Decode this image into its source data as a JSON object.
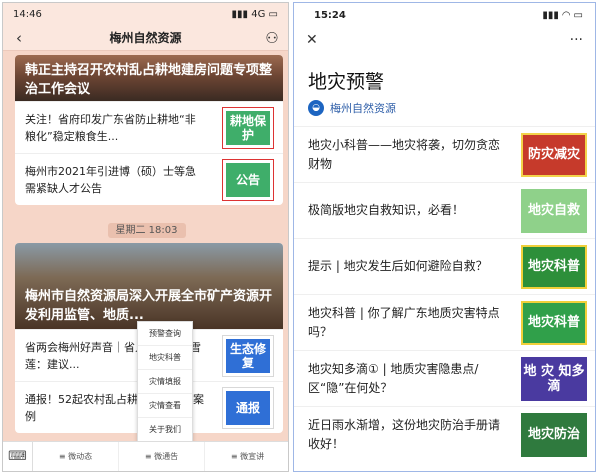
{
  "left": {
    "status": {
      "time": "14:46",
      "signal": "4G"
    },
    "navbar": {
      "title": "梅州自然资源"
    },
    "card1": {
      "hero_text": "韩正主持召开农村乱占耕地建房问题专项整治工作会议",
      "rows": [
        {
          "text": "关注！省府印发广东省防止耕地“非粮化”稳定粮食生...",
          "thumb": "耕地保护"
        },
        {
          "text": "梅州市2021年引进博（硕）士等急需紧缺人才公告",
          "thumb": "公告"
        }
      ]
    },
    "date_label": "星期二 18:03",
    "card2": {
      "hero_text": "梅州市自然资源局深入开展全市矿产资源开发利用监管、地质...",
      "rows": [
        {
          "text": "省两会梅州好声音｜省人大代表张雪莲：建议...",
          "thumb": "生态修复"
        },
        {
          "text": "通报！52起农村乱占耕地建房典型案例",
          "thumb": "通报"
        }
      ]
    },
    "popup_menu": [
      "预警查询",
      "地灾科普",
      "灾情填报",
      "灾情查看",
      "关于我们"
    ],
    "bottom_menu": [
      "微动态",
      "微通告",
      "微宣讲"
    ]
  },
  "right": {
    "status": {
      "time": "15:24"
    },
    "page_title": "地灾预警",
    "account_name": "梅州自然资源",
    "articles": [
      {
        "title": "地灾小科普——地灾将袭，切勿贪恋财物",
        "thumb": "防灾减灾",
        "style": "t1"
      },
      {
        "title": "极简版地灾自救知识，必看！",
        "thumb": "地灾自救",
        "style": "t2"
      },
      {
        "title": "提示 | 地灾发生后如何避险自救？",
        "thumb": "地灾科普",
        "style": "t3"
      },
      {
        "title": "地灾科普 | 你了解广东地质灾害特点吗？",
        "thumb": "地灾科普",
        "style": "t4"
      },
      {
        "title": "地灾知多滴① | 地质灾害隐患点/区“隐”在何处？",
        "thumb": "地 灾 知多滴",
        "style": "t5"
      },
      {
        "title": "近日雨水渐增，这份地灾防治手册请收好！",
        "thumb": "地灾防治",
        "style": "t6"
      }
    ]
  },
  "icons": {
    "back": "back-arrow-icon",
    "user": "user-icon",
    "close": "close-icon",
    "more": "more-dots-icon",
    "keyboard": "keyboard-icon"
  }
}
